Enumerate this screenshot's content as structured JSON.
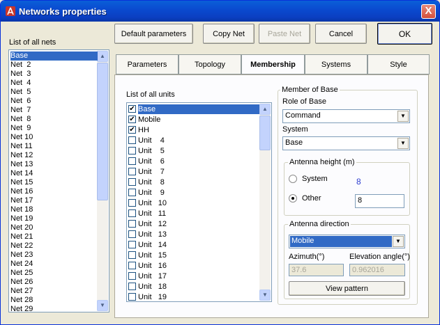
{
  "window": {
    "title": "Networks properties",
    "close_label": "X"
  },
  "icons": {
    "app": "network-app-icon",
    "scroll_up": "scroll-up-arrow-icon",
    "scroll_down": "scroll-down-arrow-icon",
    "dropdown": "chevron-down-icon"
  },
  "colors": {
    "title_bar": "#0a4bd0",
    "selection": "#316ac5",
    "window_bg": "#ece9d8",
    "value_blue": "#2d3ecf"
  },
  "toolbar": {
    "default_params": "Default parameters",
    "copy_net": "Copy Net",
    "paste_net": "Paste Net",
    "cancel": "Cancel",
    "ok": "OK"
  },
  "nets": {
    "label": "List of all nets",
    "items": [
      "Base",
      "Net  2",
      "Net  3",
      "Net  4",
      "Net  5",
      "Net  6",
      "Net  7",
      "Net  8",
      "Net  9",
      "Net 10",
      "Net 11",
      "Net 12",
      "Net 13",
      "Net 14",
      "Net 15",
      "Net 16",
      "Net 17",
      "Net 18",
      "Net 19",
      "Net 20",
      "Net 21",
      "Net 22",
      "Net 23",
      "Net 24",
      "Net 25",
      "Net 26",
      "Net 27",
      "Net 28",
      "Net 29"
    ],
    "selected_index": 0
  },
  "tabs": [
    "Parameters",
    "Topology",
    "Membership",
    "Systems",
    "Style"
  ],
  "active_tab": 2,
  "units": {
    "label": "List of all units",
    "items": [
      {
        "label": "Base",
        "checked": true
      },
      {
        "label": "Mobile",
        "checked": true
      },
      {
        "label": "HH",
        "checked": true
      },
      {
        "label": "Unit    4",
        "checked": false
      },
      {
        "label": "Unit    5",
        "checked": false
      },
      {
        "label": "Unit    6",
        "checked": false
      },
      {
        "label": "Unit    7",
        "checked": false
      },
      {
        "label": "Unit    8",
        "checked": false
      },
      {
        "label": "Unit    9",
        "checked": false
      },
      {
        "label": "Unit   10",
        "checked": false
      },
      {
        "label": "Unit   11",
        "checked": false
      },
      {
        "label": "Unit   12",
        "checked": false
      },
      {
        "label": "Unit   13",
        "checked": false
      },
      {
        "label": "Unit   14",
        "checked": false
      },
      {
        "label": "Unit   15",
        "checked": false
      },
      {
        "label": "Unit   16",
        "checked": false
      },
      {
        "label": "Unit   17",
        "checked": false
      },
      {
        "label": "Unit   18",
        "checked": false
      },
      {
        "label": "Unit   19",
        "checked": false
      }
    ],
    "selected_index": 0,
    "check_mark": "✔"
  },
  "member": {
    "legend": "Member of Base",
    "role_label": "Role of Base",
    "role_value": "Command",
    "system_label": "System",
    "system_value": "Base",
    "antenna_height": {
      "legend": "Antenna height (m)",
      "system_label": "System",
      "system_value": "8",
      "other_label": "Other",
      "other_value": "8",
      "selected": "other"
    },
    "antenna_direction": {
      "legend": "Antenna direction",
      "mode_value": "Mobile",
      "azimuth_label": "Azimuth(°)",
      "azimuth_value": "37.6",
      "elevation_label": "Elevation angle(°)",
      "elevation_value": "0.962016",
      "view_pattern": "View pattern"
    }
  }
}
